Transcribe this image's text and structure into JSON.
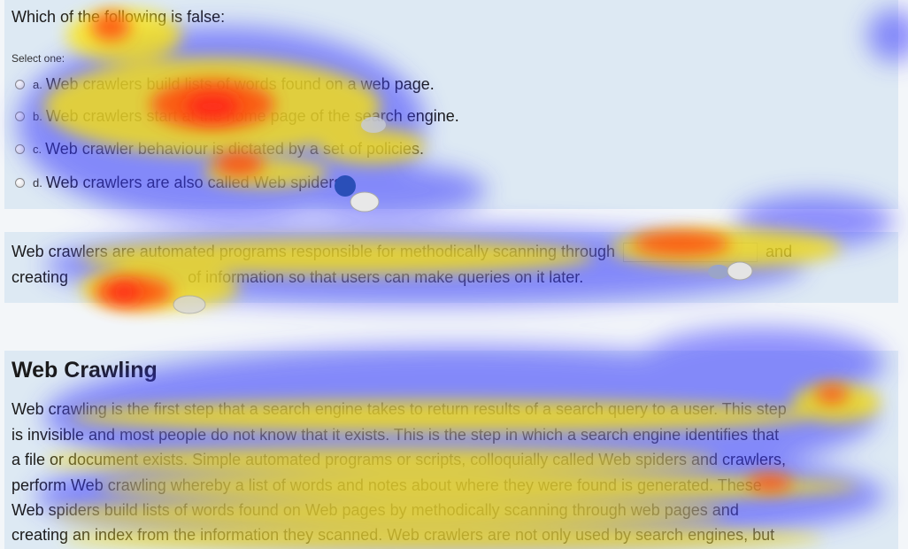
{
  "question": {
    "text": "Which of the following is false:",
    "select_label": "Select one:",
    "options": [
      {
        "letter": "a.",
        "text": "Web crawlers build lists of words found on a web page."
      },
      {
        "letter": "b.",
        "text": "Web crawlers start at the home page of the search engine."
      },
      {
        "letter": "c.",
        "text": "Web crawler behaviour is dictated by a set of policies."
      },
      {
        "letter": "d.",
        "text": "Web crawlers are also called Web spiders."
      }
    ]
  },
  "cloze": {
    "line1_before": "Web crawlers are automated programs responsible for methodically scanning through",
    "line1_after": "and",
    "line2_before": "creating",
    "line2_after": "of information so that users can make queries on it later."
  },
  "content": {
    "heading": "Web Crawling",
    "lines": [
      "Web crawling is the first step that a search engine takes to return results of a search query to a user. This step",
      "is invisible and most people do not know that it exists. This is the step in which a search engine identifies that",
      "a file or document exists. Simple automated programs or scripts, colloquially called Web spiders and crawlers,",
      "perform Web crawling whereby a list of words and notes about where they were found is generated. These",
      "Web spiders build lists of words found on Web pages by methodically scanning through web pages and",
      "creating an index from the information they scanned. Web crawlers are not only used by search engines, but"
    ]
  },
  "colors": {
    "panel_bg": "#dde9f3",
    "heat_hot": "#ff1a1a",
    "heat_warm": "#ffe600",
    "heat_cool": "#3a3aff"
  }
}
